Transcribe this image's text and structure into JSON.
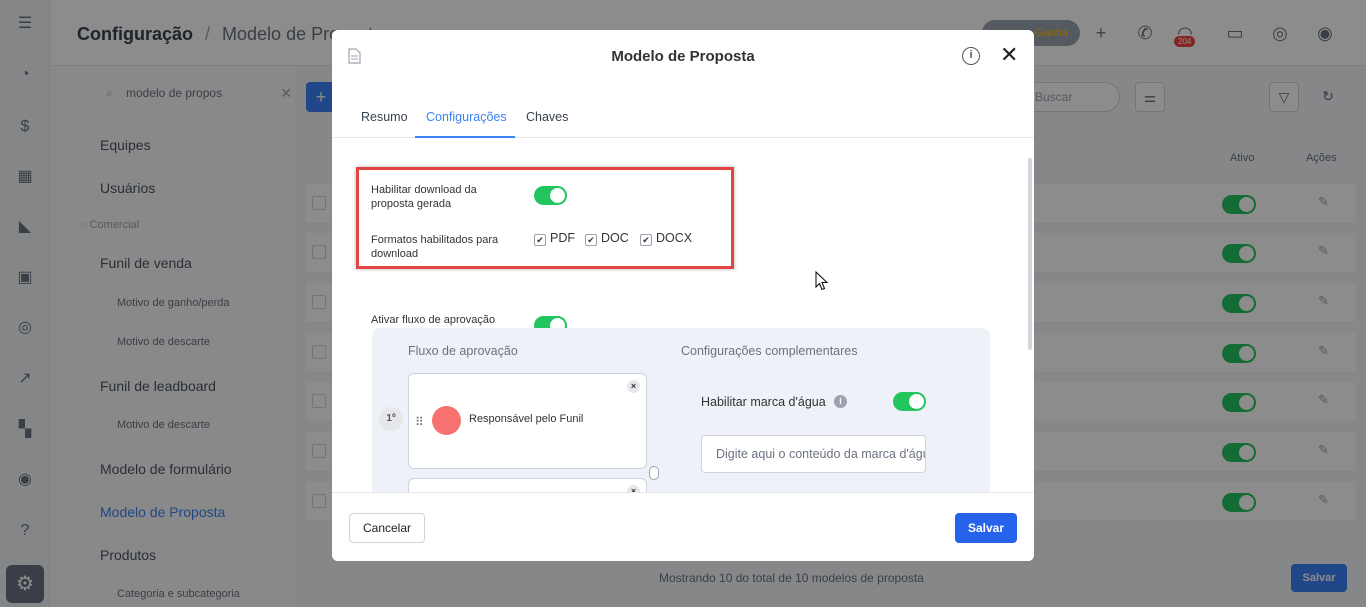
{
  "rail": {
    "icons": [
      "menu-icon",
      "dashboard-icon",
      "money-icon",
      "building-icon",
      "chart-icon",
      "calendar-icon",
      "check-icon",
      "trend-icon",
      "grid-icon",
      "target-icon",
      "help-icon",
      "gear-icon"
    ]
  },
  "topbar": {
    "breadcrumb_root": "Configuração",
    "breadcrumb_sep": "/",
    "breadcrumb_current": "Modelo de Proposta",
    "gain_button": "Ganha",
    "badge": "204"
  },
  "subnav": {
    "search_value": "modelo de propos",
    "items": {
      "equipes": "Equipes",
      "usuarios": "Usuários",
      "comercial": "Comercial",
      "funil_venda": "Funil de venda",
      "motivo_ganho": "Motivo de ganho/perda",
      "motivo_descarte_1": "Motivo de descarte",
      "funil_leadboard": "Funil de leadboard",
      "motivo_descarte_2": "Motivo de descarte",
      "modelo_formulario": "Modelo de formulário",
      "modelo_proposta": "Modelo de Proposta",
      "produtos": "Produtos",
      "categoria": "Categoria e subcategoria"
    }
  },
  "main": {
    "add_label": "+",
    "search_placeholder": "Buscar",
    "col_ativo": "Ativo",
    "col_acoes": "Ações",
    "footer_text": "Mostrando 10 do total de 10 modelos de proposta",
    "save_label": "Salvar"
  },
  "modal": {
    "title": "Modelo de Proposta",
    "info": "i",
    "close": "✕",
    "tabs": {
      "resumo": "Resumo",
      "configuracoes": "Configurações",
      "chaves": "Chaves"
    },
    "download_label": "Habilitar download da proposta gerada",
    "formats_label": "Formatos habilitados para download",
    "formats": {
      "pdf": "PDF",
      "doc": "DOC",
      "docx": "DOCX"
    },
    "check_mark": "✔",
    "approval_label": "Ativar fluxo de aprovação",
    "flow_header": "Fluxo de aprovação",
    "extra_header": "Configurações complementares",
    "step": "1º",
    "card_close": "×",
    "responsible": "Responsável pelo Funil",
    "watermark_label": "Habilitar marca d'água",
    "watermark_info": "i",
    "watermark_placeholder": "Digite aqui o conteúdo da marca d'água",
    "cancel": "Cancelar",
    "save": "Salvar"
  }
}
